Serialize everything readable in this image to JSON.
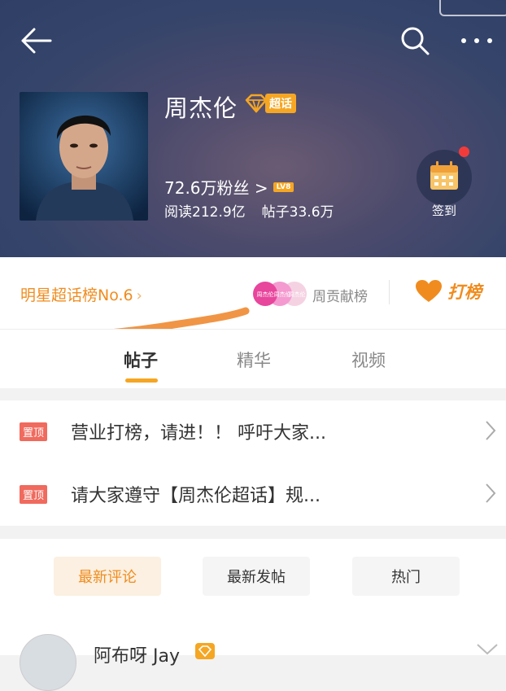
{
  "header": {
    "name": "周杰伦",
    "super_topic_badge": "超话",
    "fans": "72.6万粉丝 >",
    "level_badge": "LV8",
    "reads": "阅读212.9亿",
    "posts": "帖子33.6万",
    "checkin_label": "签到"
  },
  "rank": {
    "label": "明星超话榜No.6",
    "arrow": "›",
    "contributors": [
      "周杰伦",
      "周杰伦",
      "周杰伦"
    ],
    "contrib_label": "周贡献榜",
    "action_label": "打榜"
  },
  "tabs": [
    {
      "label": "帖子",
      "active": true
    },
    {
      "label": "精华",
      "active": false
    },
    {
      "label": "视频",
      "active": false
    }
  ],
  "pinned": [
    {
      "tag": "置顶",
      "text": "营业打榜，请进！！ 呼吁大家..."
    },
    {
      "tag": "置顶",
      "text": "请大家遵守【周杰伦超话】规..."
    }
  ],
  "filters": [
    {
      "label": "最新评论",
      "active": true
    },
    {
      "label": "最新发帖",
      "active": false
    },
    {
      "label": "热门",
      "active": false
    }
  ],
  "first_post": {
    "author": "阿布呀 Jay"
  },
  "colors": {
    "accent": "#f08c1f",
    "badge": "#f5a623",
    "pin_tag": "#f06a5e",
    "header_bg": "#3a466b"
  }
}
